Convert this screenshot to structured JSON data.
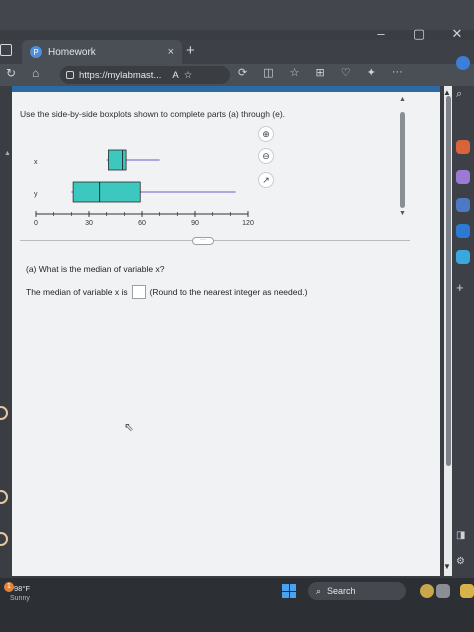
{
  "browser": {
    "tab_title": "Homework",
    "tab_close": "×",
    "new_tab": "+",
    "url_host": "https://mylabmast...",
    "read_aloud": "A",
    "more": "···"
  },
  "window": {
    "minimize": "–",
    "restore": "▢",
    "close": "✕"
  },
  "page": {
    "instruction": "Use the side-by-side boxplots shown to complete parts (a) through (e).",
    "question_a": "(a) What is the median of variable x?",
    "median_prefix": "The median of variable x is",
    "median_hint": "(Round to the nearest integer as needed.)",
    "median_value": "",
    "expand_label": "···"
  },
  "chart_data": {
    "type": "boxplot",
    "xlim": [
      0,
      120
    ],
    "ticks": [
      "0",
      "30",
      "60",
      "90",
      "120"
    ],
    "tick_values": [
      0,
      30,
      60,
      90,
      120
    ],
    "series": [
      {
        "name": "x",
        "min": 40,
        "q1": 41,
        "median": 49,
        "q3": 51,
        "max": 70
      },
      {
        "name": "y",
        "min": 20,
        "q1": 21,
        "median": 36,
        "q3": 59,
        "max": 113
      }
    ],
    "box_color": "#3cc8be"
  },
  "taskbar": {
    "temperature": "98°F",
    "condition": "Sunny",
    "search_label": "Search",
    "weather_badge": "1"
  }
}
